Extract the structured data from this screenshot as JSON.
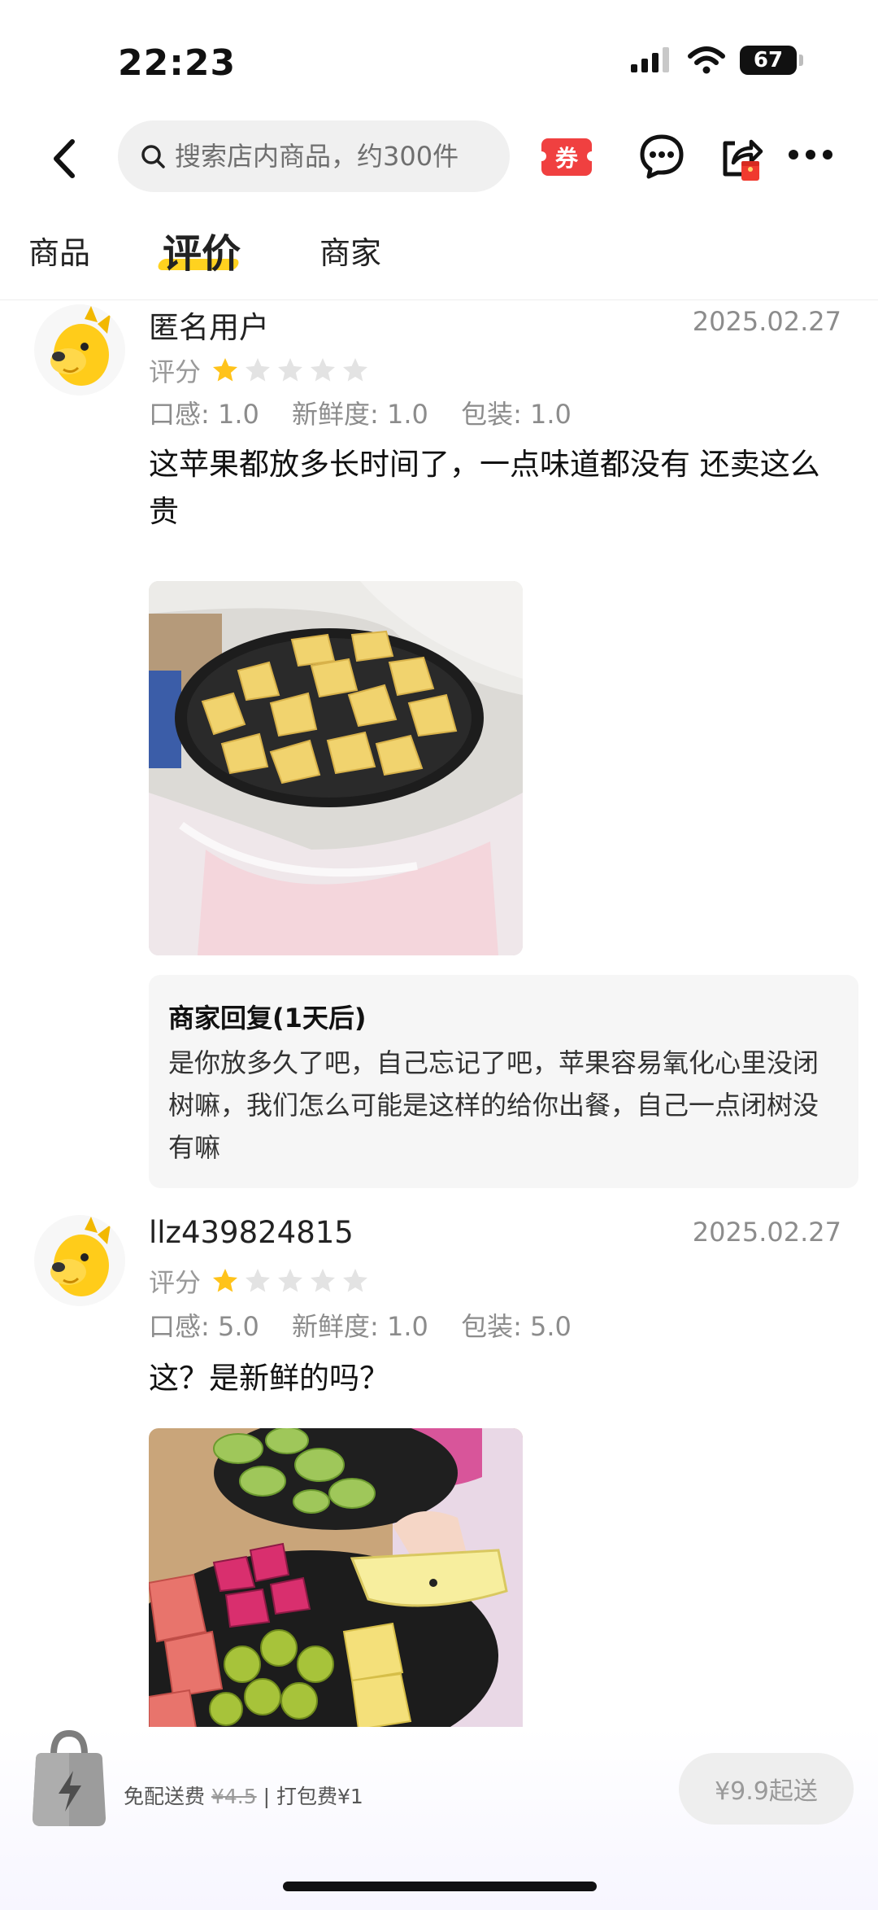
{
  "status_bar": {
    "time": "22:23",
    "battery": "67"
  },
  "search": {
    "placeholder": "搜索店内商品，约300件"
  },
  "nav": {
    "coupon_label": "券"
  },
  "tabs": [
    {
      "label": "商品",
      "active": false
    },
    {
      "label": "评价",
      "active": true
    },
    {
      "label": "商家",
      "active": false
    }
  ],
  "reviews": [
    {
      "username": "匿名用户",
      "date": "2025.02.27",
      "rating_label": "评分",
      "stars": 1,
      "max_stars": 5,
      "scores": {
        "taste": "口感: 1.0",
        "freshness": "新鲜度: 1.0",
        "packaging": "包装: 1.0"
      },
      "text": "这苹果都放多长时间了，一点味道都没有 还卖这么贵",
      "reply": {
        "title": "商家回复(1天后)",
        "text": "是你放多久了吧，自己忘记了吧，苹果容易氧化心里没闭树嘛，我们怎么可能是这样的给你出餐，自己一点闭树没有嘛"
      }
    },
    {
      "username": "llz439824815",
      "date": "2025.02.27",
      "rating_label": "评分",
      "stars": 1,
      "max_stars": 5,
      "scores": {
        "taste": "口感: 5.0",
        "freshness": "新鲜度: 1.0",
        "packaging": "包装: 5.0"
      },
      "text": "这？是新鲜的吗？"
    }
  ],
  "bottom_bar": {
    "free_delivery": "免配送费",
    "original_fee": "¥4.5",
    "separator": "|",
    "packing_fee": "打包费¥1",
    "checkout": "¥9.9起送"
  },
  "colors": {
    "accent": "#ffd21f",
    "coupon": "#f04040",
    "star_on": "#ffc31a",
    "star_off": "#e3e3e3"
  }
}
